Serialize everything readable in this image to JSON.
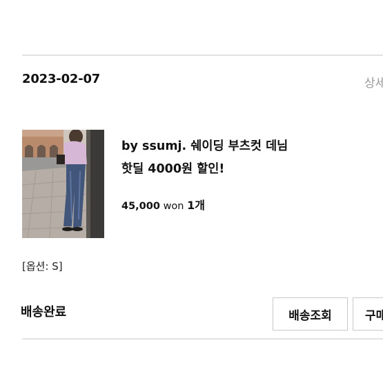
{
  "order": {
    "date": "2023-02-07",
    "detail_link": "상세",
    "status": "배송완료"
  },
  "product": {
    "name_line1": "by ssumj. 쉐이딩 부츠컷 데님",
    "name_line2": "핫딜 4000원 할인!",
    "price": "45,000",
    "currency": "won",
    "quantity": "1개",
    "option": "[옵션: S]",
    "image_alt": "product-photo"
  },
  "actions": {
    "track_label": "배송조회",
    "buy_label": "구매"
  },
  "colors": {
    "divider": "#e2e2e2",
    "muted_text": "#9a9a9a",
    "button_border": "#c9c9c9"
  }
}
